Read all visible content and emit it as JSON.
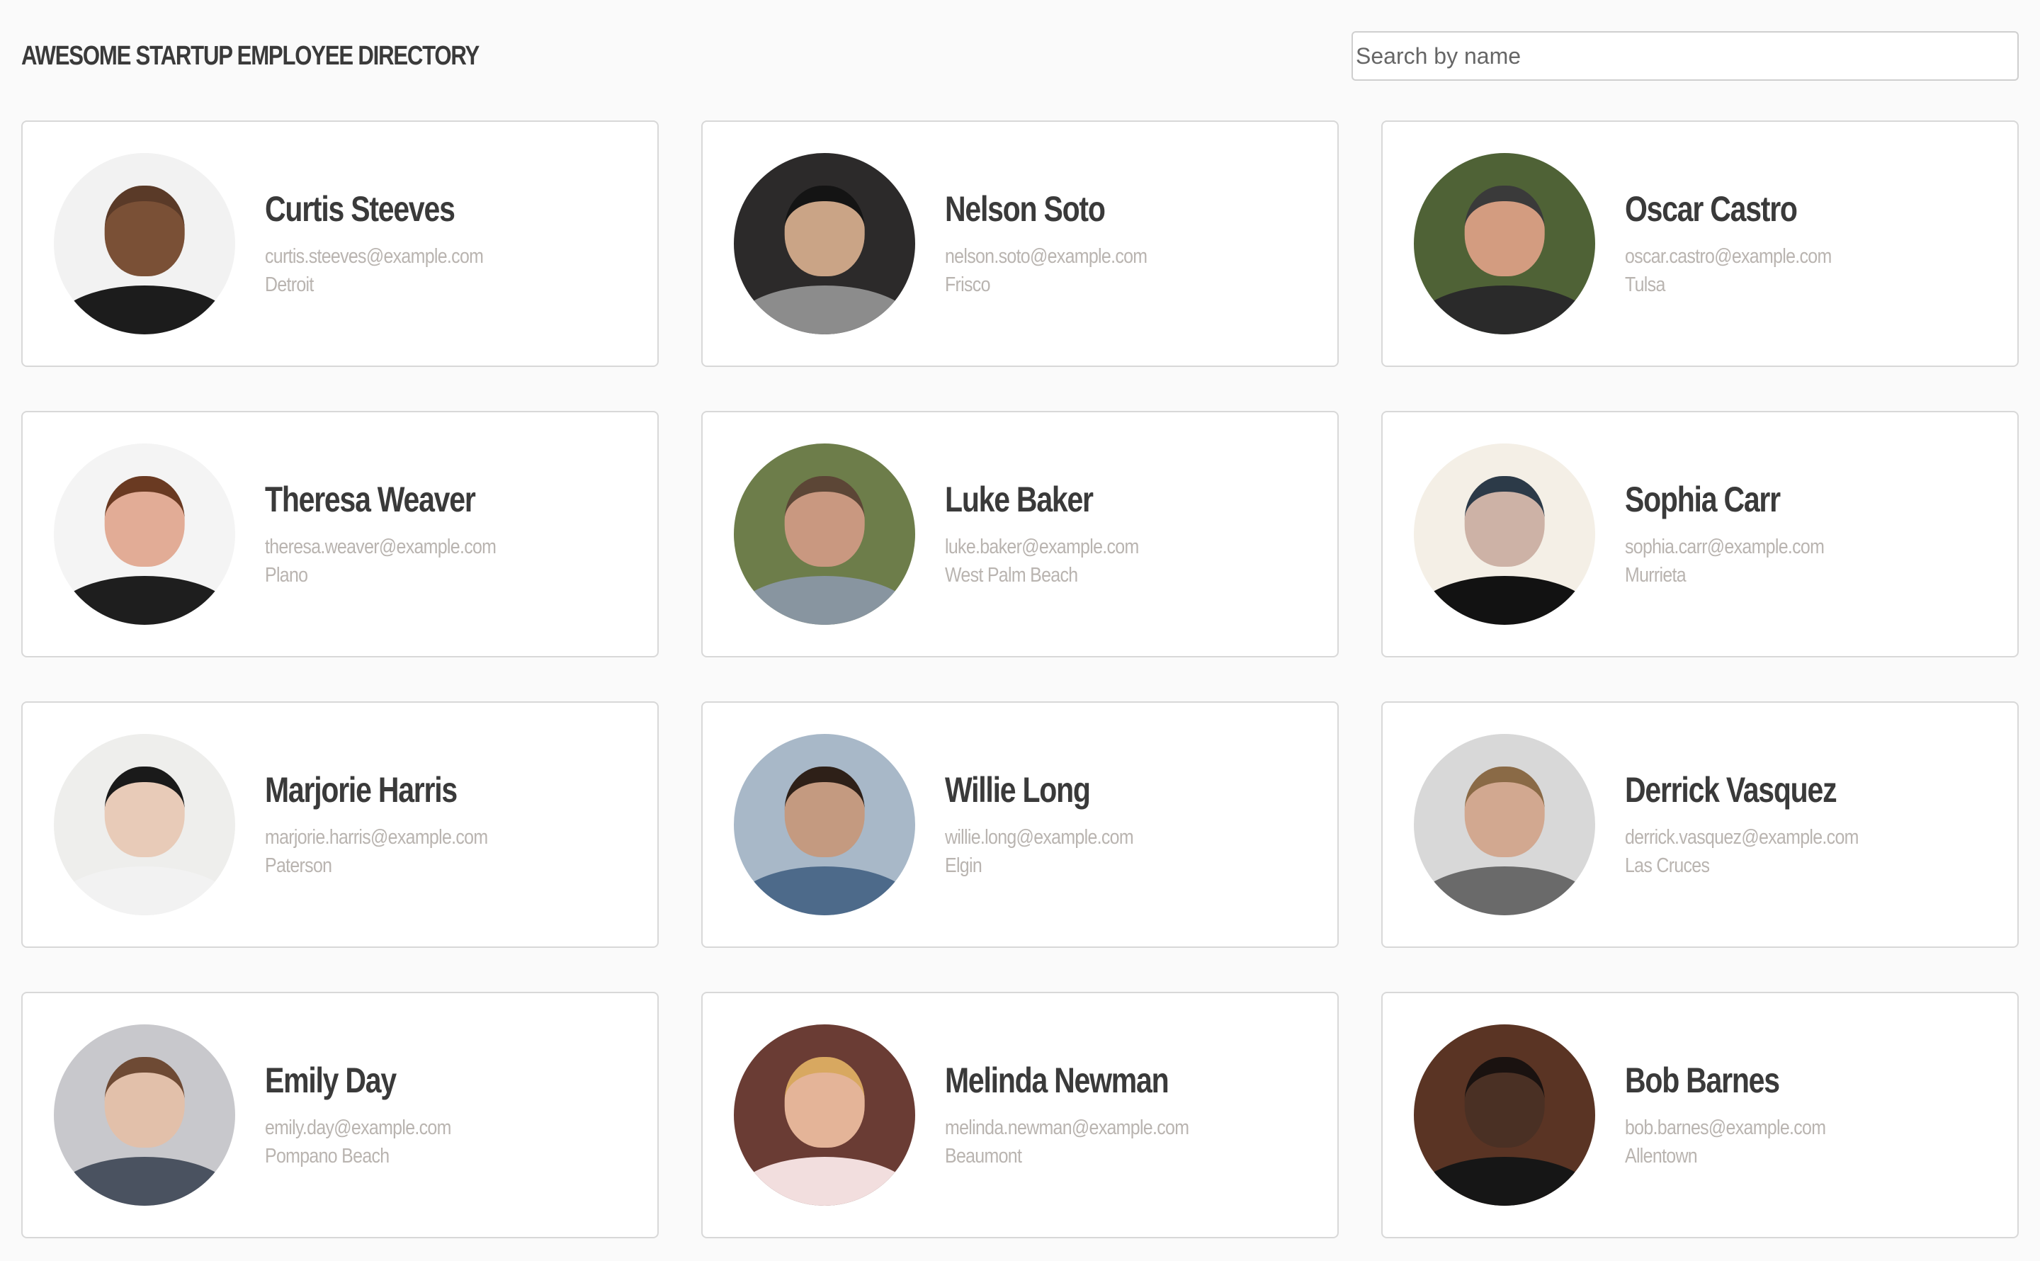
{
  "header": {
    "title": "AWESOME STARTUP EMPLOYEE DIRECTORY",
    "search_placeholder": "Search by name"
  },
  "employees": [
    {
      "name": "Curtis Steeves",
      "email": "curtis.steeves@example.com",
      "city": "Detroit",
      "colors": {
        "bg": "#f2f2f2",
        "skin": "#7a5036",
        "hair": "#5a3a28",
        "shirt": "#1c1c1c"
      }
    },
    {
      "name": "Nelson Soto",
      "email": "nelson.soto@example.com",
      "city": "Frisco",
      "colors": {
        "bg": "#2c2a2a",
        "skin": "#caa486",
        "hair": "#141414",
        "shirt": "#8c8c8c"
      }
    },
    {
      "name": "Oscar Castro",
      "email": "oscar.castro@example.com",
      "city": "Tulsa",
      "colors": {
        "bg": "#4f6236",
        "skin": "#d39c80",
        "hair": "#3a3a3a",
        "shirt": "#2a2a2a"
      }
    },
    {
      "name": "Theresa Weaver",
      "email": "theresa.weaver@example.com",
      "city": "Plano",
      "colors": {
        "bg": "#f4f4f4",
        "skin": "#e2ac96",
        "hair": "#6a3a22",
        "shirt": "#1e1e1e"
      }
    },
    {
      "name": "Luke Baker",
      "email": "luke.baker@example.com",
      "city": "West Palm Beach",
      "colors": {
        "bg": "#6d7d4a",
        "skin": "#c99880",
        "hair": "#5c4636",
        "shirt": "#8895a0"
      }
    },
    {
      "name": "Sophia Carr",
      "email": "sophia.carr@example.com",
      "city": "Murrieta",
      "colors": {
        "bg": "#f4efe6",
        "skin": "#cdb2a6",
        "hair": "#2c3a48",
        "shirt": "#121212"
      }
    },
    {
      "name": "Marjorie Harris",
      "email": "marjorie.harris@example.com",
      "city": "Paterson",
      "colors": {
        "bg": "#eeeeec",
        "skin": "#e8cbb8",
        "hair": "#1a1a1a",
        "shirt": "#f2f2f2"
      }
    },
    {
      "name": "Willie Long",
      "email": "willie.long@example.com",
      "city": "Elgin",
      "colors": {
        "bg": "#a8b8c8",
        "skin": "#c49a80",
        "hair": "#2e2018",
        "shirt": "#4d6a8a"
      }
    },
    {
      "name": "Derrick Vasquez",
      "email": "derrick.vasquez@example.com",
      "city": "Las Cruces",
      "colors": {
        "bg": "#d8d8d8",
        "skin": "#d2a890",
        "hair": "#8a6a46",
        "shirt": "#6a6a6a"
      }
    },
    {
      "name": "Emily Day",
      "email": "emily.day@example.com",
      "city": "Pompano Beach",
      "colors": {
        "bg": "#c8c8cc",
        "skin": "#e2c0aa",
        "hair": "#6e4a34",
        "shirt": "#4a5260"
      }
    },
    {
      "name": "Melinda Newman",
      "email": "melinda.newman@example.com",
      "city": "Beaumont",
      "colors": {
        "bg": "#6a3c34",
        "skin": "#e4b498",
        "hair": "#d8a860",
        "shirt": "#f2dede"
      }
    },
    {
      "name": "Bob Barnes",
      "email": "bob.barnes@example.com",
      "city": "Allentown",
      "colors": {
        "bg": "#5a3424",
        "skin": "#4a3024",
        "hair": "#1a1210",
        "shirt": "#161616"
      }
    }
  ]
}
